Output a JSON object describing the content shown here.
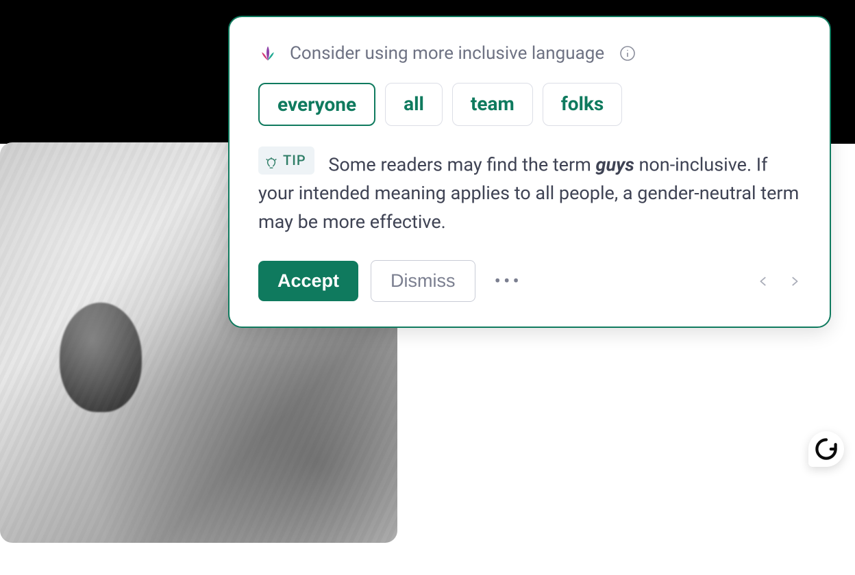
{
  "card": {
    "header_title": "Consider using more inclusive language",
    "suggestions": [
      {
        "label": "everyone",
        "selected": true
      },
      {
        "label": "all",
        "selected": false
      },
      {
        "label": "team",
        "selected": false
      },
      {
        "label": "folks",
        "selected": false
      }
    ],
    "tip": {
      "badge": "TIP",
      "text_before": "Some readers may find the term ",
      "highlight": "guys",
      "text_after": " non-inclusive. If your intended meaning applies to all people, a gender-neutral term may be more effective."
    },
    "actions": {
      "accept": "Accept",
      "dismiss": "Dismiss"
    }
  },
  "icons": {
    "logo": "lotus-icon",
    "info": "info-icon",
    "bulb": "bulb-icon",
    "more": "more-icon",
    "prev": "chevron-left-icon",
    "next": "chevron-right-icon",
    "brand": "grammarly-g-icon"
  }
}
